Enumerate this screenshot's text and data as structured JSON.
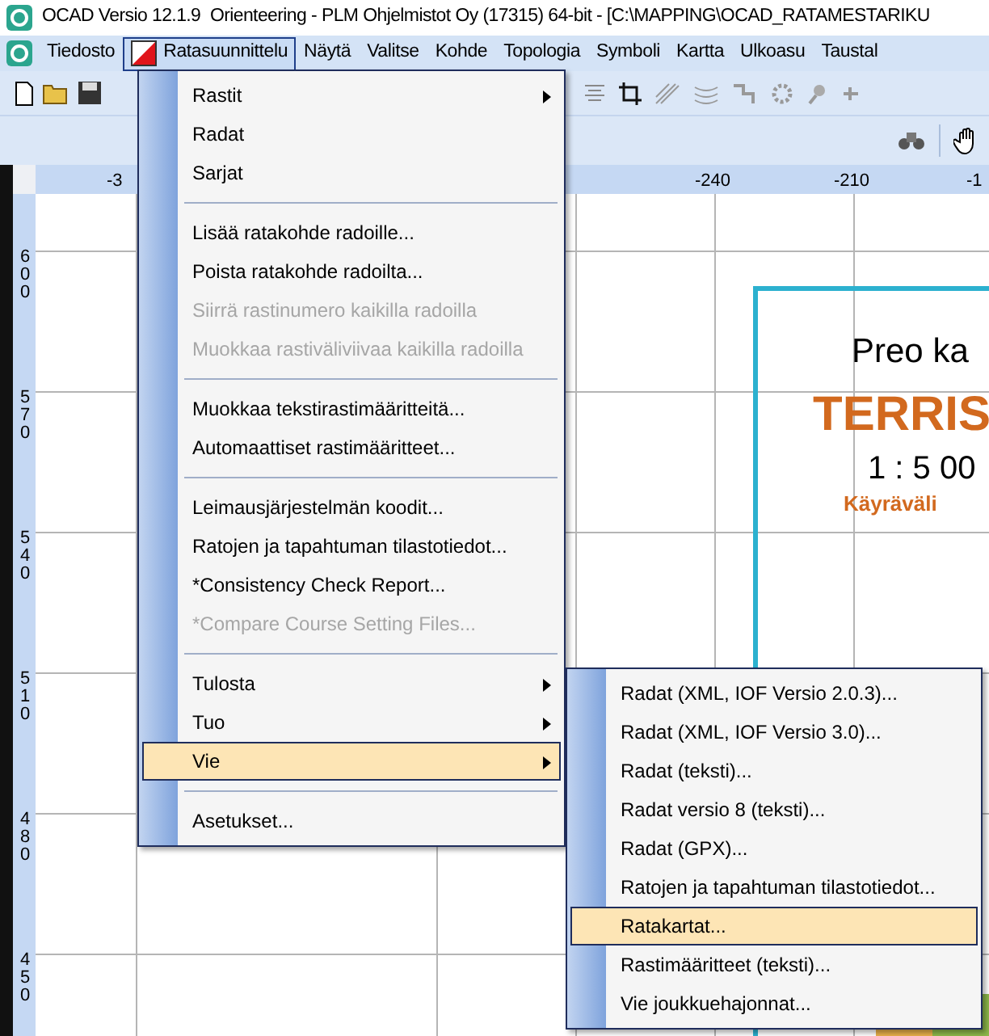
{
  "window": {
    "title": "OCAD Versio 12.1.9  Orienteering - PLM Ohjelmistot Oy (17315) 64-bit - [C:\\MAPPING\\OCAD_RATAMESTARIKU"
  },
  "menu_bar": [
    {
      "label": "Tiedosto",
      "selected": false
    },
    {
      "label": "Ratasuunnittelu",
      "selected": true
    },
    {
      "label": "Näytä",
      "selected": false
    },
    {
      "label": "Valitse",
      "selected": false
    },
    {
      "label": "Kohde",
      "selected": false
    },
    {
      "label": "Topologia",
      "selected": false
    },
    {
      "label": "Symboli",
      "selected": false
    },
    {
      "label": "Kartta",
      "selected": false
    },
    {
      "label": "Ulkoasu",
      "selected": false
    },
    {
      "label": "Taustal",
      "selected": false
    }
  ],
  "dropdown_menu": [
    {
      "kind": "item",
      "label": "Rastit",
      "submenu": true,
      "disabled": false,
      "selected": false
    },
    {
      "kind": "item",
      "label": "Radat",
      "submenu": false,
      "disabled": false,
      "selected": false
    },
    {
      "kind": "item",
      "label": "Sarjat",
      "submenu": false,
      "disabled": false,
      "selected": false
    },
    {
      "kind": "separator"
    },
    {
      "kind": "item",
      "label": "Lisää ratakohde radoille...",
      "submenu": false,
      "disabled": false,
      "selected": false
    },
    {
      "kind": "item",
      "label": "Poista ratakohde radoilta...",
      "submenu": false,
      "disabled": false,
      "selected": false
    },
    {
      "kind": "item",
      "label": "Siirrä rastinumero kaikilla radoilla",
      "submenu": false,
      "disabled": true,
      "selected": false
    },
    {
      "kind": "item",
      "label": "Muokkaa rastiväliviivaa kaikilla radoilla",
      "submenu": false,
      "disabled": true,
      "selected": false
    },
    {
      "kind": "separator"
    },
    {
      "kind": "item",
      "label": "Muokkaa tekstirastimääritteitä...",
      "submenu": false,
      "disabled": false,
      "selected": false
    },
    {
      "kind": "item",
      "label": "Automaattiset rastimääritteet...",
      "submenu": false,
      "disabled": false,
      "selected": false
    },
    {
      "kind": "separator"
    },
    {
      "kind": "item",
      "label": "Leimausjärjestelmän koodit...",
      "submenu": false,
      "disabled": false,
      "selected": false
    },
    {
      "kind": "item",
      "label": "Ratojen ja tapahtuman tilastotiedot...",
      "submenu": false,
      "disabled": false,
      "selected": false
    },
    {
      "kind": "item",
      "label": "*Consistency Check Report...",
      "submenu": false,
      "disabled": false,
      "selected": false
    },
    {
      "kind": "item",
      "label": "*Compare Course Setting Files...",
      "submenu": false,
      "disabled": true,
      "selected": false
    },
    {
      "kind": "separator"
    },
    {
      "kind": "item",
      "label": "Tulosta",
      "submenu": true,
      "disabled": false,
      "selected": false
    },
    {
      "kind": "item",
      "label": "Tuo",
      "submenu": true,
      "disabled": false,
      "selected": false
    },
    {
      "kind": "item",
      "label": "Vie",
      "submenu": true,
      "disabled": false,
      "selected": true
    },
    {
      "kind": "separator"
    },
    {
      "kind": "item",
      "label": "Asetukset...",
      "submenu": false,
      "disabled": false,
      "selected": false
    }
  ],
  "submenu": [
    {
      "label": "Radat (XML, IOF Versio 2.0.3)...",
      "selected": false
    },
    {
      "label": "Radat (XML, IOF Versio 3.0)...",
      "selected": false
    },
    {
      "label": "Radat (teksti)...",
      "selected": false
    },
    {
      "label": "Radat versio 8 (teksti)...",
      "selected": false
    },
    {
      "label": "Radat (GPX)...",
      "selected": false
    },
    {
      "label": "Ratojen ja tapahtuman tilastotiedot...",
      "selected": false
    },
    {
      "label": "Ratakartat...",
      "selected": true
    },
    {
      "label": "Rastimääritteet (teksti)...",
      "selected": false
    },
    {
      "label": "Vie joukkuehajonnat...",
      "selected": false
    }
  ],
  "top_ruler": [
    "-3",
    "-240",
    "-210",
    "-1"
  ],
  "left_ruler": [
    "600",
    "570",
    "540",
    "510",
    "480",
    "450"
  ],
  "map": {
    "texts": [
      "Preo ka",
      "TERRIS",
      "1 : 5 00",
      "Käyräväli"
    ]
  }
}
